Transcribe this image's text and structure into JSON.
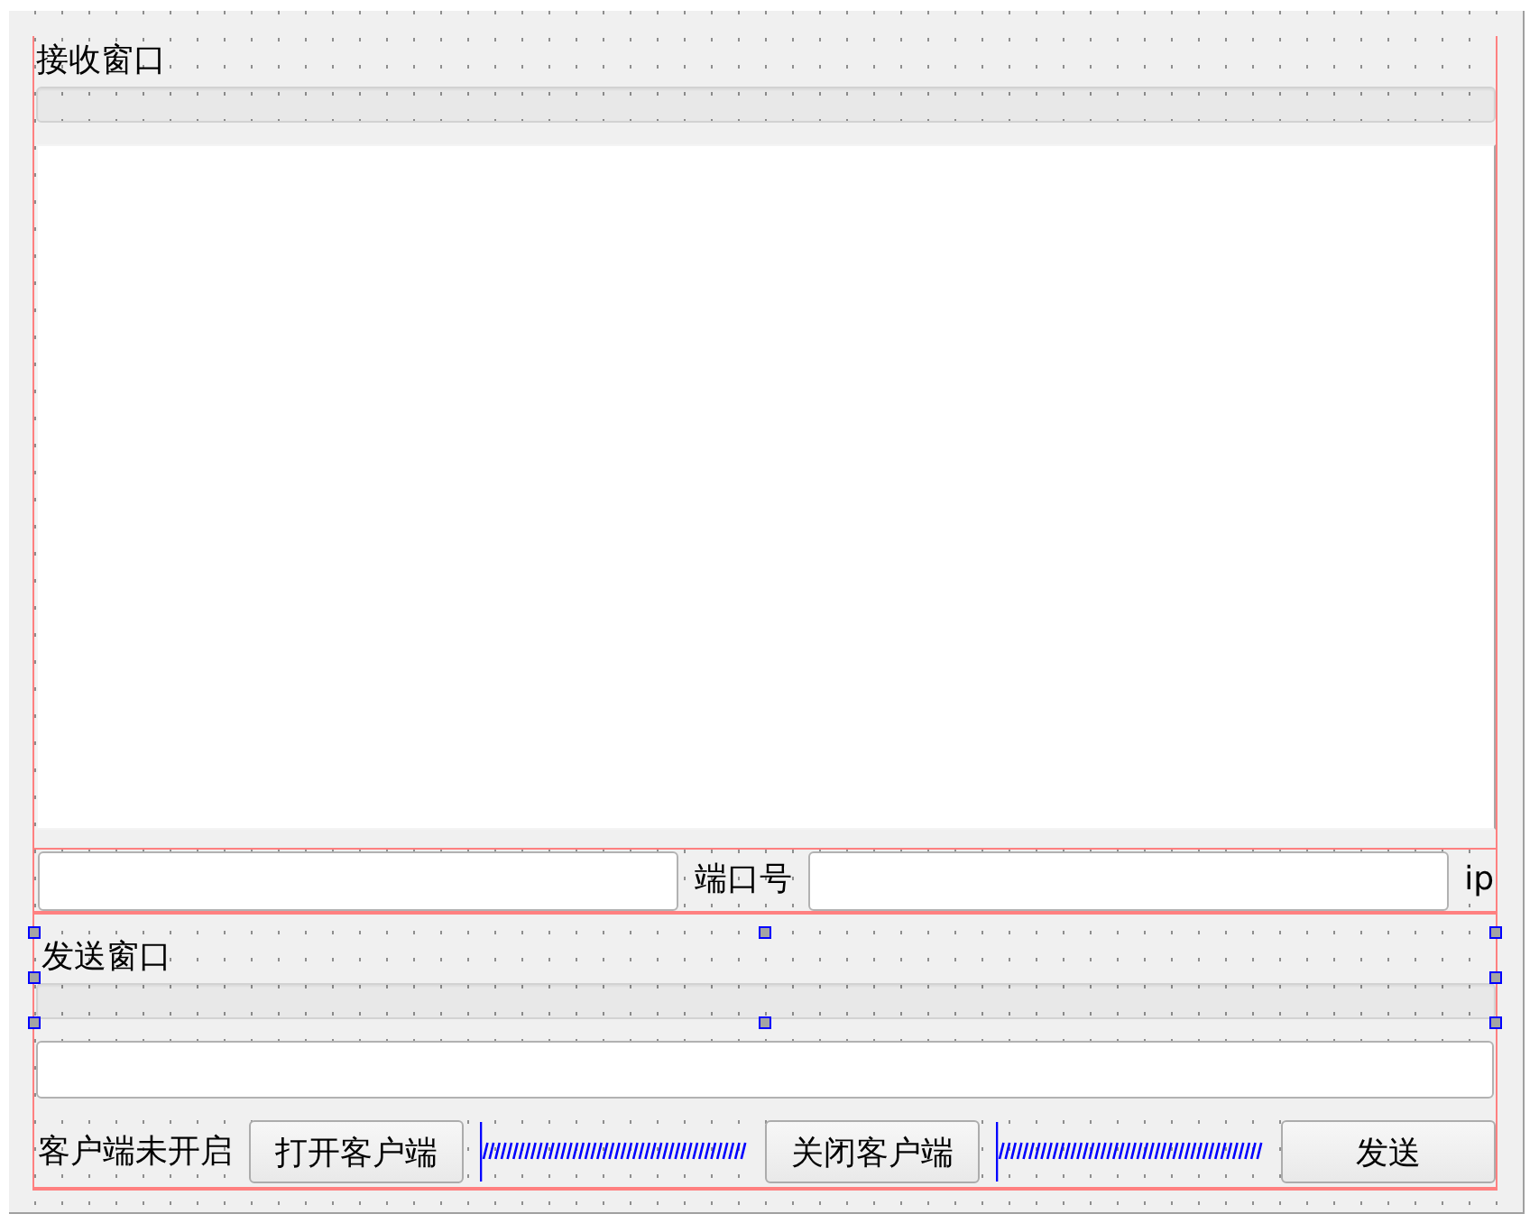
{
  "form": {
    "rows": [
      {
        "kind": "header",
        "label": "接收窗口",
        "selected": false
      },
      {
        "kind": "text_area"
      },
      {
        "kind": "layout_row",
        "items": [
          {
            "kind": "field"
          },
          {
            "kind": "label",
            "text": "端口号"
          },
          {
            "kind": "field"
          },
          {
            "kind": "label",
            "text": "ip"
          }
        ]
      },
      {
        "kind": "header",
        "label": "发送窗口",
        "selected": true
      },
      {
        "kind": "field"
      },
      {
        "kind": "row",
        "items": [
          {
            "kind": "label",
            "text": "客户端未开启"
          },
          {
            "kind": "button",
            "label": "打开客户端"
          },
          {
            "kind": "spacer"
          },
          {
            "kind": "button",
            "label": "关闭客户端"
          },
          {
            "kind": "spacer"
          },
          {
            "kind": "button",
            "label": "发送"
          }
        ]
      }
    ]
  }
}
